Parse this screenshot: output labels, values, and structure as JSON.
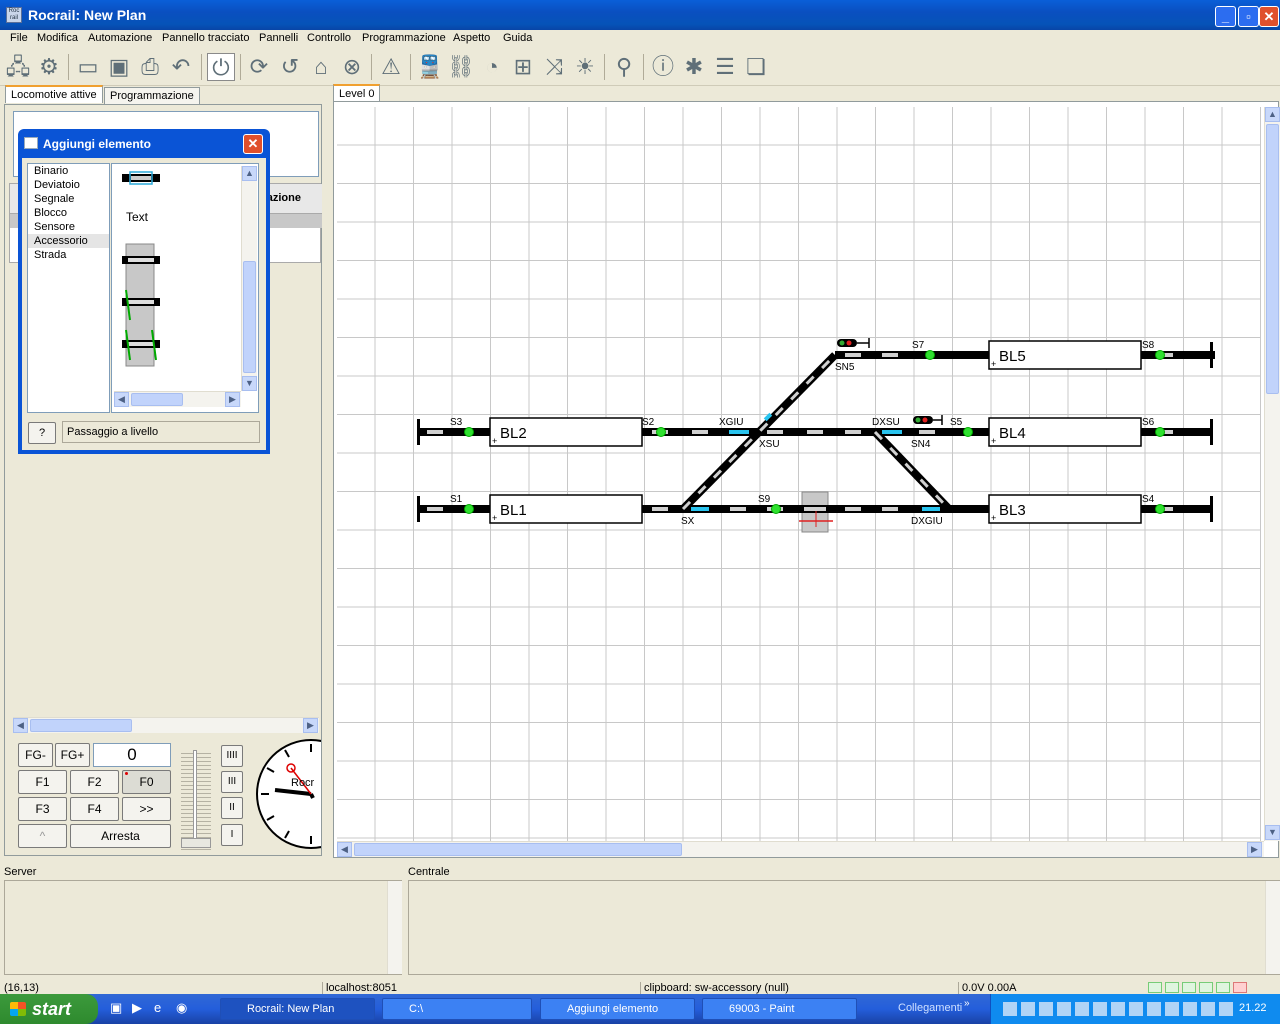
{
  "window": {
    "title": "Rocrail: New Plan"
  },
  "menu": [
    "File",
    "Modifica",
    "Automazione",
    "Pannello tracciato",
    "Pannelli",
    "Controllo",
    "Programmazione",
    "Aspetto",
    "Guida"
  ],
  "toolbar_icons": [
    "connect-icon",
    "settings-icon",
    "open-icon",
    "save-icon",
    "print-icon",
    "undo-icon",
    "power-icon",
    "sync-icon",
    "reset-icon",
    "home-icon",
    "stop-icon",
    "warning-icon",
    "locomotive-icon",
    "cars-icon",
    "gauge-icon",
    "routes-icon",
    "shuffle-icon",
    "light-icon",
    "search-icon",
    "info-icon",
    "bug-icon",
    "list-icon",
    "pages-icon"
  ],
  "left_tabs": {
    "active": "Locomotive attive",
    "other": "Programmazione"
  },
  "left_column_header": "nazione",
  "dialog": {
    "title": "Aggiungi elemento",
    "categories": [
      "Binario",
      "Deviatoio",
      "Segnale",
      "Blocco",
      "Sensore",
      "Accessorio",
      "Strada"
    ],
    "selected": "Accessorio",
    "preview_text": "Text",
    "help_label": "?",
    "selected_item": "Passaggio a livello"
  },
  "throttle": {
    "fg_minus": "FG-",
    "fg_plus": "FG+",
    "speed": "0",
    "f1": "F1",
    "f2": "F2",
    "f0": "F0",
    "f3": "F3",
    "f4": "F4",
    "more": ">>",
    "up": "^",
    "stop": "Arresta",
    "steps": [
      "IIII",
      "III",
      "II",
      "I"
    ],
    "clock_text": "Rocr"
  },
  "plan": {
    "tab": "Level 0",
    "blocks": [
      "BL5",
      "BL2",
      "BL4",
      "BL1",
      "BL3"
    ],
    "labels": {
      "s7": "S7",
      "s8": "S8",
      "sn5": "SN5",
      "s3": "S3",
      "s2": "S2",
      "xgiu": "XGIU",
      "dxsu": "DXSU",
      "s5": "S5",
      "s6": "S6",
      "xsu": "XSU",
      "sn4": "SN4",
      "s1": "S1",
      "s9": "S9",
      "s4": "S4",
      "sx": "SX",
      "dxgiu": "DXGIU"
    }
  },
  "panels": {
    "server": "Server",
    "central": "Centrale"
  },
  "status": {
    "coords": "(16,13)",
    "host": "localhost:8051",
    "clipboard": "clipboard: sw-accessory (null)",
    "power": "0.0V 0.00A"
  },
  "taskbar": {
    "start": "start",
    "tasks": [
      "Rocrail: New Plan",
      "C:\\",
      "Aggiungi elemento",
      "69003 - Paint"
    ],
    "links": "Collegamenti",
    "clock": "21.22"
  }
}
